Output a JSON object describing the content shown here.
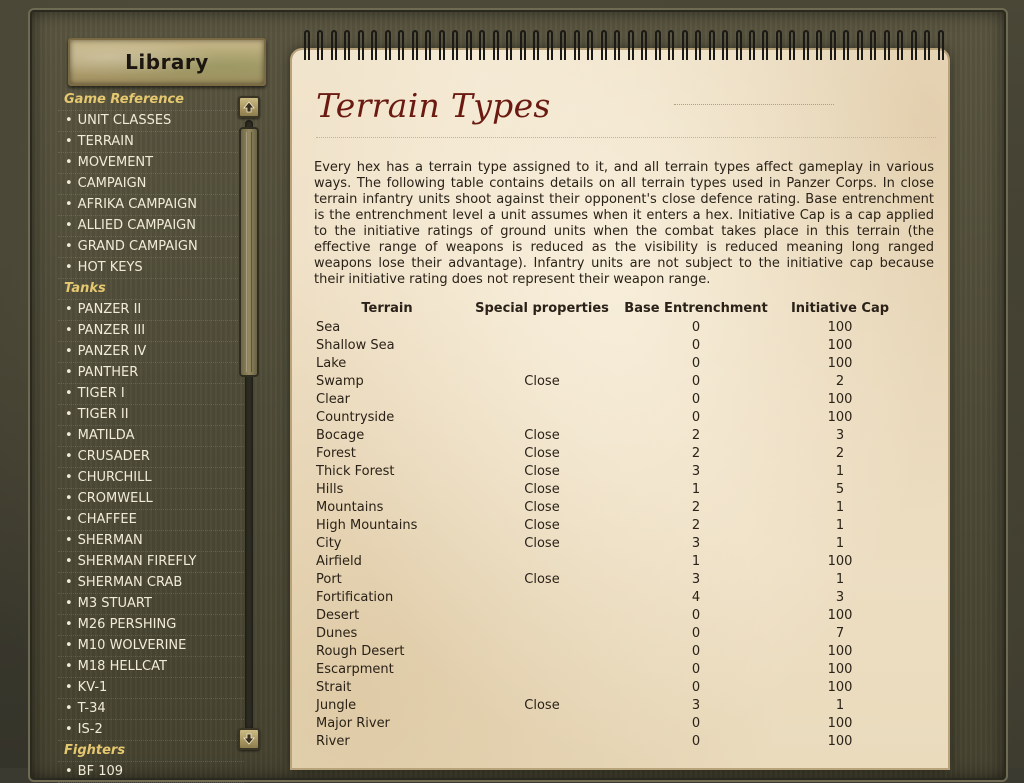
{
  "library": {
    "title": "Library"
  },
  "nav": [
    {
      "type": "section",
      "label": "Game Reference"
    },
    {
      "type": "item",
      "label": "UNIT CLASSES"
    },
    {
      "type": "item",
      "label": "TERRAIN"
    },
    {
      "type": "item",
      "label": "MOVEMENT"
    },
    {
      "type": "item",
      "label": "CAMPAIGN"
    },
    {
      "type": "item",
      "label": "AFRIKA CAMPAIGN"
    },
    {
      "type": "item",
      "label": "ALLIED CAMPAIGN"
    },
    {
      "type": "item",
      "label": "GRAND CAMPAIGN"
    },
    {
      "type": "item",
      "label": "HOT KEYS"
    },
    {
      "type": "section",
      "label": "Tanks"
    },
    {
      "type": "item",
      "label": "PANZER II"
    },
    {
      "type": "item",
      "label": "PANZER III"
    },
    {
      "type": "item",
      "label": "PANZER IV"
    },
    {
      "type": "item",
      "label": "PANTHER"
    },
    {
      "type": "item",
      "label": "TIGER I"
    },
    {
      "type": "item",
      "label": "TIGER II"
    },
    {
      "type": "item",
      "label": "MATILDA"
    },
    {
      "type": "item",
      "label": "CRUSADER"
    },
    {
      "type": "item",
      "label": "CHURCHILL"
    },
    {
      "type": "item",
      "label": "CROMWELL"
    },
    {
      "type": "item",
      "label": "CHAFFEE"
    },
    {
      "type": "item",
      "label": "SHERMAN"
    },
    {
      "type": "item",
      "label": "SHERMAN FIREFLY"
    },
    {
      "type": "item",
      "label": "SHERMAN CRAB"
    },
    {
      "type": "item",
      "label": "M3 STUART"
    },
    {
      "type": "item",
      "label": "M26 PERSHING"
    },
    {
      "type": "item",
      "label": "M10 WOLVERINE"
    },
    {
      "type": "item",
      "label": "M18 HELLCAT"
    },
    {
      "type": "item",
      "label": "KV-1"
    },
    {
      "type": "item",
      "label": "T-34"
    },
    {
      "type": "item",
      "label": "IS-2"
    },
    {
      "type": "section",
      "label": "Fighters"
    },
    {
      "type": "item",
      "label": "BF 109"
    }
  ],
  "page": {
    "title": "Terrain Types",
    "intro": "Every hex has a terrain type assigned to it, and all terrain types affect gameplay in various ways. The following table contains details on all terrain types used in Panzer Corps. In close terrain infantry units shoot against their opponent's close defence rating. Base entrenchment is the entrenchment level a unit assumes when it enters a hex. Initiative Cap is a cap applied to the initiative ratings of ground units when the combat takes place in this terrain (the effective range of weapons is reduced as the visibility is reduced meaning long ranged weapons lose their advantage). Infantry units are not subject to the initiative cap because their initiative rating does not represent their weapon range."
  },
  "table": {
    "headers": [
      "Terrain",
      "Special properties",
      "Base Entrenchment",
      "Initiative Cap"
    ],
    "rows": [
      [
        "Sea",
        "",
        "0",
        "100"
      ],
      [
        "Shallow Sea",
        "",
        "0",
        "100"
      ],
      [
        "Lake",
        "",
        "0",
        "100"
      ],
      [
        "Swamp",
        "Close",
        "0",
        "2"
      ],
      [
        "Clear",
        "",
        "0",
        "100"
      ],
      [
        "Countryside",
        "",
        "0",
        "100"
      ],
      [
        "Bocage",
        "Close",
        "2",
        "3"
      ],
      [
        "Forest",
        "Close",
        "2",
        "2"
      ],
      [
        "Thick Forest",
        "Close",
        "3",
        "1"
      ],
      [
        "Hills",
        "Close",
        "1",
        "5"
      ],
      [
        "Mountains",
        "Close",
        "2",
        "1"
      ],
      [
        "High Mountains",
        "Close",
        "2",
        "1"
      ],
      [
        "City",
        "Close",
        "3",
        "1"
      ],
      [
        "Airfield",
        "",
        "1",
        "100"
      ],
      [
        "Port",
        "Close",
        "3",
        "1"
      ],
      [
        "Fortification",
        "",
        "4",
        "3"
      ],
      [
        "Desert",
        "",
        "0",
        "100"
      ],
      [
        "Dunes",
        "",
        "0",
        "7"
      ],
      [
        "Rough Desert",
        "",
        "0",
        "100"
      ],
      [
        "Escarpment",
        "",
        "0",
        "100"
      ],
      [
        "Strait",
        "",
        "0",
        "100"
      ],
      [
        "Jungle",
        "Close",
        "3",
        "1"
      ],
      [
        "Major River",
        "",
        "0",
        "100"
      ],
      [
        "River",
        "",
        "0",
        "100"
      ]
    ]
  },
  "scroll": {
    "position": 0
  },
  "icons": {
    "up": "arrow-up-icon",
    "down": "arrow-down-icon"
  },
  "colors": {
    "title": "#6b1a12",
    "section": "#e6c870",
    "nav_text": "#f1ecd8",
    "paper": "#efe0c6"
  }
}
